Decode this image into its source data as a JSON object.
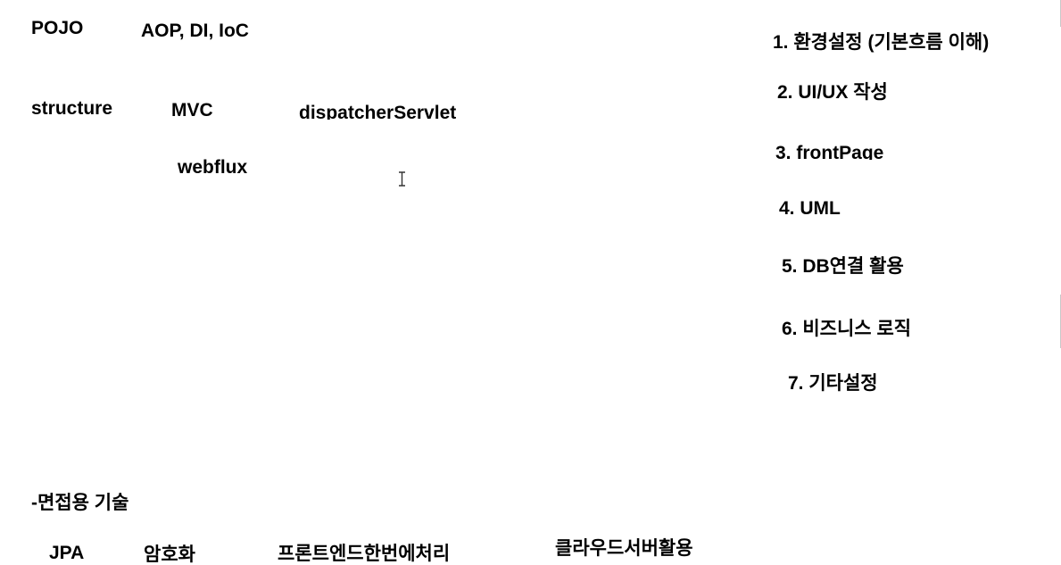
{
  "left": {
    "pojo": "POJO",
    "aop": "AOP, DI, IoC",
    "structure": "structure",
    "mvc": "MVC",
    "dispatcher": "dispatcherServlet",
    "webflux": "webflux"
  },
  "steps": [
    "1. 환경설정 (기본흐름 이해)",
    "2. UI/UX 작성",
    "3. frontPage",
    "4. UML",
    "5. DB연결 활용",
    "6. 비즈니스 로직",
    "7. 기타설정"
  ],
  "interview": {
    "heading": "-면접용 기술",
    "items": [
      "JPA",
      "암호화",
      "프론트엔드한번에처리",
      "클라우드서버활용"
    ]
  },
  "cursor_icon": "text-cursor-icon"
}
